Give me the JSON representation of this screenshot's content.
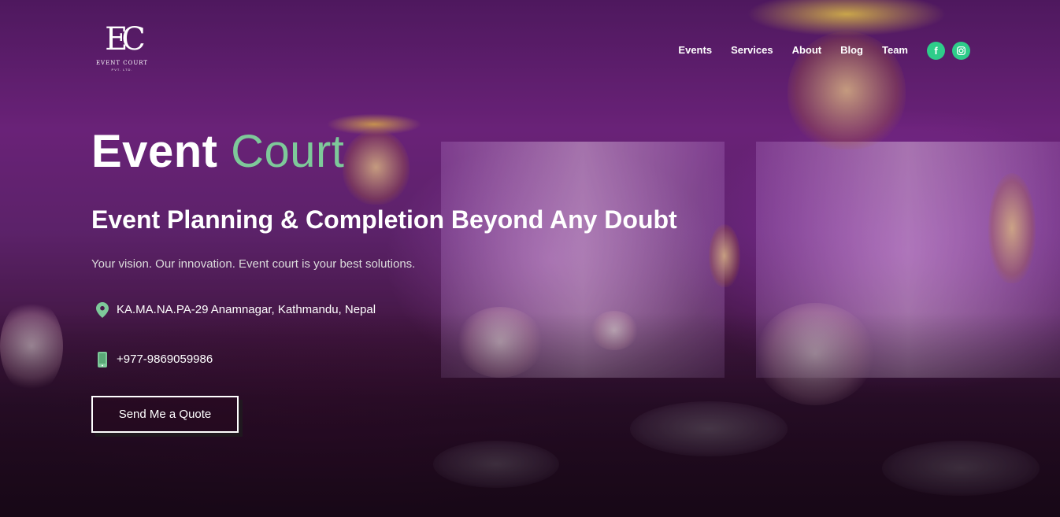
{
  "header": {
    "logo": {
      "mark": "EC",
      "name": "EVENT COURT",
      "sub": "PVT. LTD."
    },
    "nav": [
      "Events",
      "Services",
      "About",
      "Blog",
      "Team"
    ],
    "social": [
      {
        "icon": "facebook-icon",
        "glyph": "f"
      },
      {
        "icon": "instagram-icon"
      }
    ],
    "accent_color": "#2ecc8a"
  },
  "hero": {
    "title_main": "Event ",
    "title_accent": "Court",
    "title_accent_color": "#7ec99a",
    "subtitle": "Event Planning & Completion Beyond Any Doubt",
    "tagline": "Your vision. Our innovation. Event court is your best solutions.",
    "address": "KA.MA.NA.PA-29 Anamnagar, Kathmandu, Nepal",
    "phone": "+977-9869059986",
    "cta_label": "Send Me a Quote"
  }
}
